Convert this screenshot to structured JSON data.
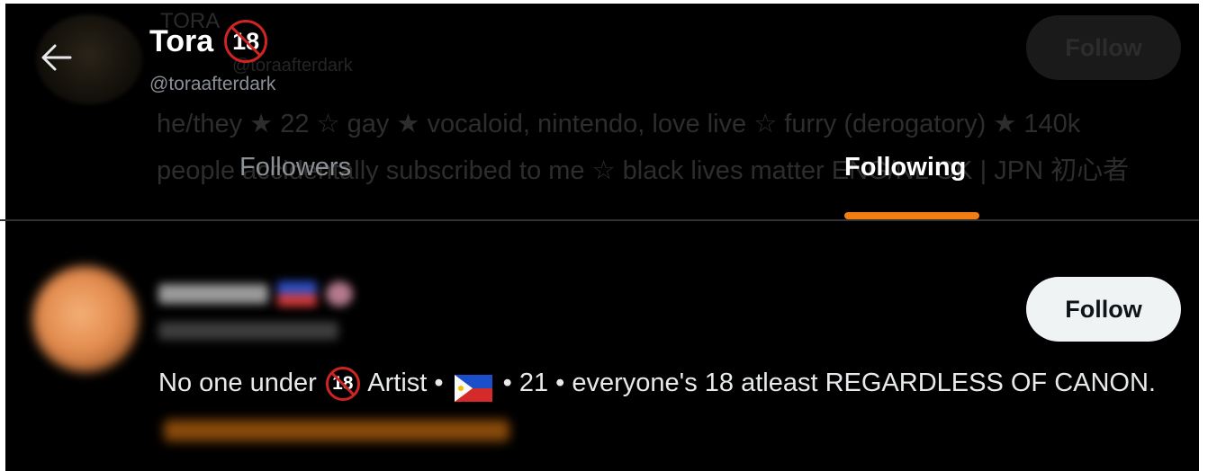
{
  "profile": {
    "name": "Tora",
    "badge": "18",
    "handle": "@toraafterdark",
    "ghost_name": "TORA",
    "ghost_handle": "@toraafterdark",
    "ghost_bio": "he/they ★ 22 ☆ gay ★ vocaloid, nintendo, love live ☆ furry (derogatory) ★ 140k people accidentally subscribed to me ☆ black lives matter ENG/NL OK | JPN 初心者",
    "ghost_follow_label": "Follow"
  },
  "tabs": [
    {
      "label": "Followers",
      "active": false
    },
    {
      "label": "Following",
      "active": true
    }
  ],
  "user": {
    "follow_label": "Follow",
    "bio_part1": "No one under ",
    "bio_badge": "18",
    "bio_part2": " Artist • ",
    "bio_part3": " • 21 • everyone's 18 atleast REGARDLESS OF CANON."
  },
  "colors": {
    "accent": "#f17d13",
    "background": "#000000",
    "badge_red": "#cf2424"
  },
  "icons": [
    "back-arrow-icon",
    "no-under-18-icon",
    "philippines-flag-icon"
  ]
}
